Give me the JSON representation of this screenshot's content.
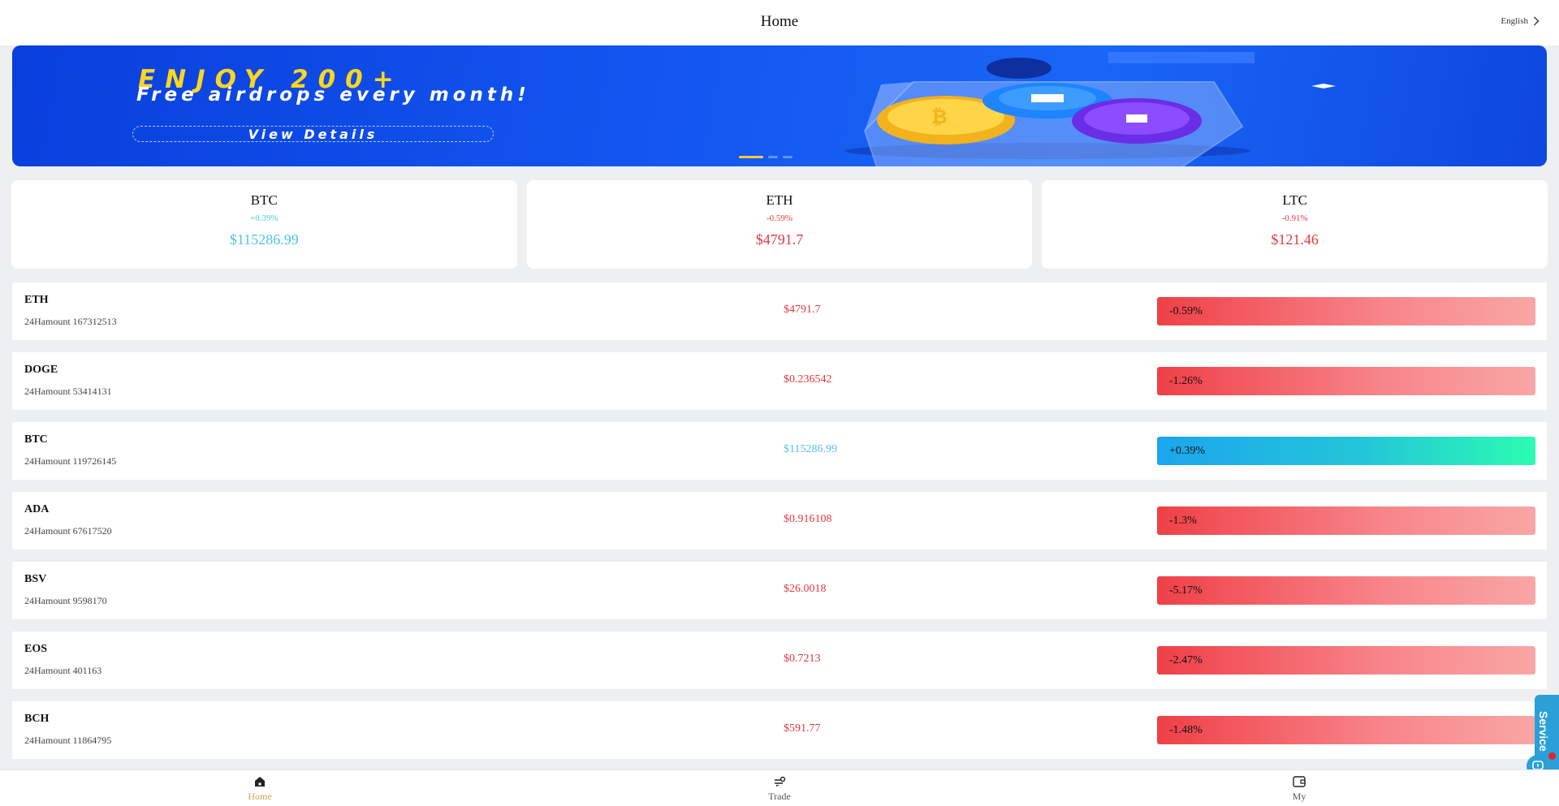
{
  "header": {
    "title": "Home",
    "language": "English"
  },
  "banner": {
    "headline": "ENJOY 200+",
    "subline": "Free airdrops every month!",
    "button": "View Details",
    "slides": 3,
    "active_slide": 1
  },
  "summary_cards": [
    {
      "symbol": "BTC",
      "change": "+0.39%",
      "price": "$115286.99",
      "trend": "up"
    },
    {
      "symbol": "ETH",
      "change": "-0.59%",
      "price": "$4791.7",
      "trend": "down"
    },
    {
      "symbol": "LTC",
      "change": "-0.91%",
      "price": "$121.46",
      "trend": "down"
    }
  ],
  "market_list": [
    {
      "symbol": "ETH",
      "volume": "24Hamount 167312513",
      "price": "$4791.7",
      "change": "-0.59%",
      "trend": "down"
    },
    {
      "symbol": "DOGE",
      "volume": "24Hamount 53414131",
      "price": "$0.236542",
      "change": "-1.26%",
      "trend": "down"
    },
    {
      "symbol": "BTC",
      "volume": "24Hamount 119726145",
      "price": "$115286.99",
      "change": "+0.39%",
      "trend": "up"
    },
    {
      "symbol": "ADA",
      "volume": "24Hamount 67617520",
      "price": "$0.916108",
      "change": "-1.3%",
      "trend": "down"
    },
    {
      "symbol": "BSV",
      "volume": "24Hamount 9598170",
      "price": "$26.0018",
      "change": "-5.17%",
      "trend": "down"
    },
    {
      "symbol": "EOS",
      "volume": "24Hamount 401163",
      "price": "$0.7213",
      "change": "-2.47%",
      "trend": "down"
    },
    {
      "symbol": "BCH",
      "volume": "24Hamount 11864795",
      "price": "$591.77",
      "change": "-1.48%",
      "trend": "down"
    }
  ],
  "service": {
    "label": "Service"
  },
  "tabbar": {
    "tabs": [
      {
        "label": "Home",
        "icon": "home-icon",
        "active": true
      },
      {
        "label": "Trade",
        "icon": "trade-icon",
        "active": false
      },
      {
        "label": "My",
        "icon": "wallet-icon",
        "active": false
      }
    ]
  },
  "colors": {
    "up": "#4ec3e2",
    "down": "#e0393f",
    "active_tab": "#c5a94d",
    "banner_blue": "#1457f0",
    "banner_yellow": "#ffd51e"
  }
}
